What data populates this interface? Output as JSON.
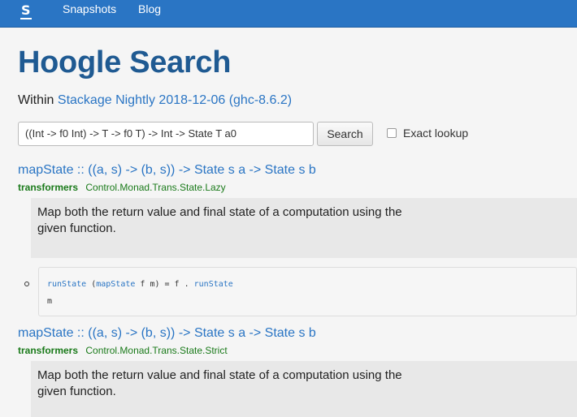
{
  "nav": {
    "logo": "S",
    "links": [
      "Snapshots",
      "Blog"
    ]
  },
  "page": {
    "title": "Hoogle Search",
    "within_prefix": "Within",
    "within_link": "Stackage Nightly 2018-12-06 (ghc-8.6.2)"
  },
  "search": {
    "query": "((Int -> f0 Int) -> T -> f0 T) -> Int -> State T a0",
    "button_label": "Search",
    "exact_label": "Exact lookup",
    "exact_checked": false
  },
  "results": [
    {
      "signature": "mapState :: ((a, s) -> (b, s)) -> State s a -> State s b",
      "package": "transformers",
      "module": "Control.Monad.Trans.State.Lazy",
      "doc": "Map both the return value and final state of a computation using the given function.",
      "code": {
        "fn1": "runState",
        "part1": " (",
        "fn2": "mapState",
        "part2": " f m) = f . ",
        "fn3": "runState",
        "line2": "m"
      }
    },
    {
      "signature": "mapState :: ((a, s) -> (b, s)) -> State s a -> State s b",
      "package": "transformers",
      "module": "Control.Monad.Trans.State.Strict",
      "doc": "Map both the return value and final state of a computation using the given function."
    }
  ],
  "colors": {
    "navbar": "#2a75c4",
    "title": "#1f5a92",
    "link": "#2a75c4",
    "package": "#1a7a1a"
  }
}
